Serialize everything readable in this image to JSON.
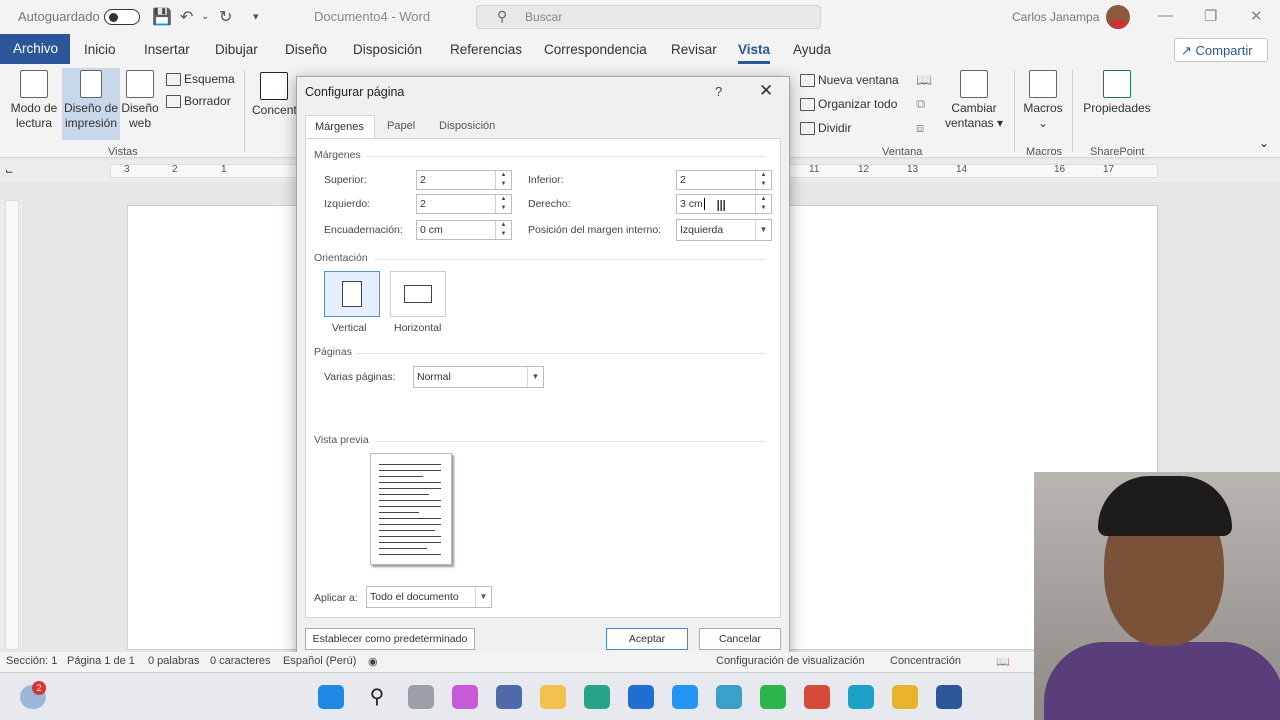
{
  "titlebar": {
    "autosave": "Autoguardado",
    "doc_title": "Documento4  -  Word",
    "search_placeholder": "Buscar",
    "user": "Carlos Janampa"
  },
  "menu": {
    "file": "Archivo",
    "tabs": [
      "Inicio",
      "Insertar",
      "Dibujar",
      "Diseño",
      "Disposición",
      "Referencias",
      "Correspondencia",
      "Revisar",
      "Vista",
      "Ayuda"
    ],
    "active": "Vista",
    "share": "Compartir"
  },
  "ribbon": {
    "modo_lectura": [
      "Modo de",
      "lectura"
    ],
    "diseno_impresion": [
      "Diseño de",
      "impresión"
    ],
    "diseno_web": [
      "Diseño",
      "web"
    ],
    "esquema": "Esquema",
    "borrador": "Borrador",
    "concent": "Concent",
    "vistas": "Vistas",
    "nueva_ventana": "Nueva ventana",
    "organizar_todo": "Organizar todo",
    "dividir": "Dividir",
    "cambiar_ventanas": [
      "Cambiar",
      "ventanas"
    ],
    "macros": "Macros",
    "propiedades": "Propiedades",
    "ventana": "Ventana",
    "macros_group": "Macros",
    "sharepoint": "SharePoint"
  },
  "ruler": {
    "left_nums": [
      "3",
      "2",
      "1"
    ],
    "right_nums": [
      "11",
      "12",
      "13",
      "14",
      "16",
      "17"
    ]
  },
  "dialog": {
    "title": "Configurar página",
    "help": "?",
    "tabs": [
      "Márgenes",
      "Papel",
      "Disposición"
    ],
    "margins_section": "Márgenes",
    "superior_label": "Superior:",
    "superior_value": "2",
    "inferior_label": "Inferior:",
    "inferior_value": "2",
    "izquierdo_label": "Izquierdo:",
    "izquierdo_value": "2",
    "derecho_label": "Derecho:",
    "derecho_value": "3 cm",
    "encuadernacion_label": "Encuadernación:",
    "encuadernacion_value": "0 cm",
    "posicion_label": "Posición del margen interno:",
    "posicion_value": "Izquierda",
    "orientation_section": "Orientación",
    "vertical": "Vertical",
    "horizontal": "Horizontal",
    "pages_section": "Páginas",
    "varias_label": "Varias páginas:",
    "varias_value": "Normal",
    "preview_section": "Vista previa",
    "aplicar_label": "Aplicar a:",
    "aplicar_value": "Todo el documento",
    "default_button": "Establecer como predeterminado",
    "ok_button": "Aceptar",
    "cancel_button": "Cancelar"
  },
  "status": {
    "section": "Sección: 1",
    "page": "Página 1 de 1",
    "words": "0 palabras",
    "chars": "0 caracteres",
    "lang": "Español (Perú)",
    "display": "Configuración de visualización",
    "focus": "Concentración"
  },
  "taskbar": {
    "badge": "2"
  },
  "colors": {
    "word_blue": "#2b579a",
    "ribbon_bg": "#f3f3f3",
    "selected_view": "#c9d7ea"
  }
}
